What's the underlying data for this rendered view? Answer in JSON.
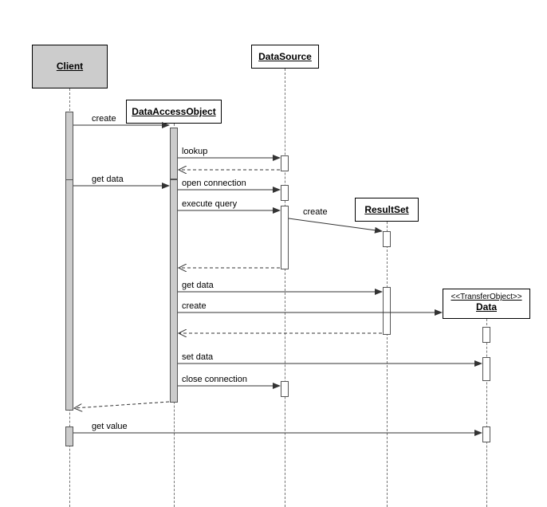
{
  "participants": {
    "client": "Client",
    "dao": "DataAccessObject",
    "datasource": "DataSource",
    "resultset": "ResultSet",
    "transferobject_stereo": "<<TransferObject>>",
    "transferobject_name": "Data"
  },
  "messages": {
    "m1": "create",
    "m2": "lookup",
    "m3": "get data",
    "m4": "open connection",
    "m5": "execute query",
    "m6": "create",
    "m7": "get data",
    "m8": "create",
    "m9": "set data",
    "m10": "close connection",
    "m11": "get value"
  }
}
